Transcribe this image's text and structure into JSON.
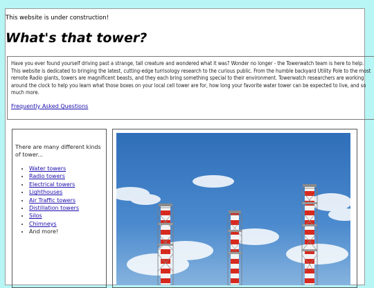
{
  "notice": "This website is under construction!",
  "title": "What's that tower?",
  "intro": {
    "text": "Have you ever found yourself driving past a strange, tall creature and wondered what it was? Wonder no longer - the Towerwatch team is here to help. This website is dedicated to bringing the latest, cutting-edge turrisology research to the curious public. From the humble backyard Utility Pole to the most remote Radio giants, towers are magnificent beasts, and they each bring something special to their environment. Towerwatch researchers are working around the clock to help you learn what those boxes on your local cell tower are for, how long your favorite water tower can be expected to live, and so much more.",
    "faq_link": "Frequently Asked Questions"
  },
  "kinds": {
    "heading": "There are many different kinds of tower...",
    "items": [
      "Water towers",
      "Radio towers",
      "Electrical towers",
      "Lighthouses",
      "Air Traffic towers",
      "Distillation towers",
      "Silos",
      "Chimneys"
    ],
    "more": "And more!"
  },
  "photo": {
    "sky_color": "#3f7fc7",
    "stripe_red": "#d62a1f",
    "stripe_white": "#f4f4f4"
  }
}
